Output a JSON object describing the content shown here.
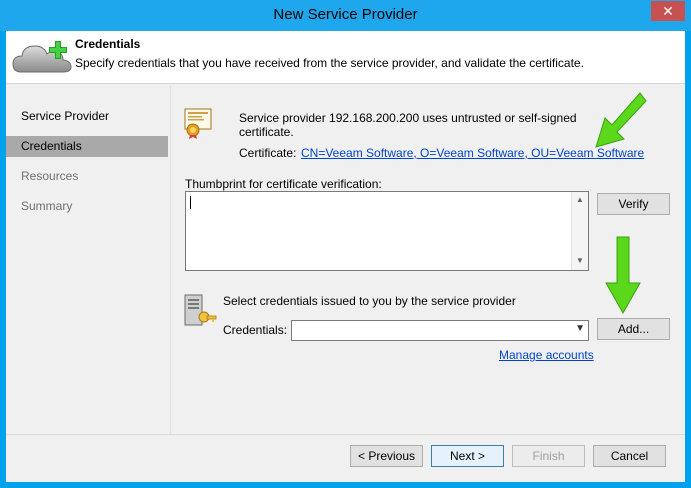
{
  "window": {
    "title": "New Service Provider",
    "close_glyph": "✕"
  },
  "header": {
    "icon": "cloud-add-icon",
    "title": "Credentials",
    "description": "Specify credentials that you have received from the service provider, and validate the certificate."
  },
  "sidebar": {
    "items": [
      {
        "label": "Service Provider",
        "state": "normal"
      },
      {
        "label": "Credentials",
        "state": "active"
      },
      {
        "label": "Resources",
        "state": "disabled"
      },
      {
        "label": "Summary",
        "state": "disabled"
      }
    ]
  },
  "certificate": {
    "icon": "certificate-icon",
    "warning": "Service provider 192.168.200.200 uses untrusted or self-signed certificate.",
    "label": "Certificate:",
    "link": "CN=Veeam Software, O=Veeam Software, OU=Veeam Software"
  },
  "thumbprint": {
    "label": "Thumbprint for certificate verification:",
    "value": "",
    "verify_button": "Verify"
  },
  "credentials": {
    "icon": "server-key-icon",
    "prompt": "Select credentials issued to you by the service provider",
    "label": "Credentials:",
    "selected": "",
    "add_button": "Add...",
    "manage_link": "Manage accounts"
  },
  "footer": {
    "previous": "< Previous",
    "next": "Next >",
    "finish": "Finish",
    "cancel": "Cancel"
  },
  "colors": {
    "title_bar": "#1ea7ec",
    "close_button": "#c75050",
    "link": "#0044cc",
    "active_nav": "#a9a9a9",
    "annotation_arrow": "#5cd81c"
  }
}
